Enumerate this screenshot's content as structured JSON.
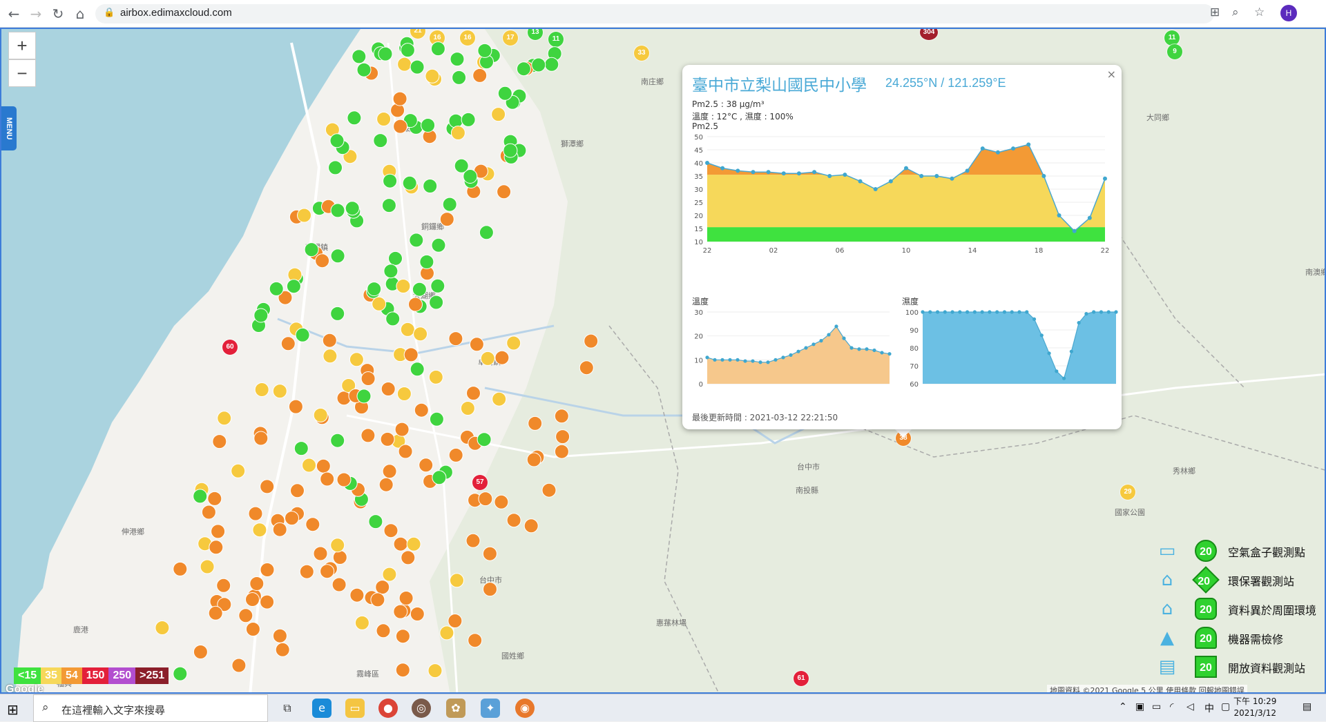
{
  "browser": {
    "url": "airbox.edimaxcloud.com",
    "profile_initial": "H"
  },
  "map_controls": {
    "zoom_in": "+",
    "zoom_out": "−",
    "menu_label": "MENU"
  },
  "place_names": [
    "南庄鄉",
    "獅潭鄉",
    "西湖鄉",
    "銅鑼鄉",
    "苑裡鎮",
    "大湖鄉",
    "卓蘭鎮",
    "大同鄉",
    "南澳鄉",
    "台中市",
    "南投縣",
    "秀林鄉",
    "國家公園",
    "伸港鄉",
    "鹿港",
    "福興",
    "國姓鄉",
    "惠蓀林場",
    "霧峰區",
    "台中市"
  ],
  "markers": [
    {
      "v": "21",
      "c": "#f6c93e"
    },
    {
      "v": "16",
      "c": "#f6c93e"
    },
    {
      "v": "16",
      "c": "#f6c93e"
    },
    {
      "v": "17",
      "c": "#f6c93e"
    },
    {
      "v": "13",
      "c": "#3fd43f"
    },
    {
      "v": "11",
      "c": "#3fd43f"
    },
    {
      "v": "33",
      "c": "#f6c93e"
    },
    {
      "v": "304",
      "c": "#a31e2c"
    },
    {
      "v": "11",
      "c": "#3fd43f"
    },
    {
      "v": "9",
      "c": "#3fd43f"
    },
    {
      "v": "60",
      "c": "#e3203a"
    },
    {
      "v": "57",
      "c": "#e3203a"
    },
    {
      "v": "38",
      "c": "#f0892a"
    },
    {
      "v": "61",
      "c": "#e3203a"
    },
    {
      "v": "29",
      "c": "#f6c93e"
    }
  ],
  "popup": {
    "title": "臺中市立梨山國民中小學",
    "coords": "24.255°N / 121.259°E",
    "pm25_reading": "Pm2.5 : 38 μg/m³",
    "temp_humidity": "溫度 : 12°C , 濕度 : 100%",
    "pm25_label": "Pm2.5",
    "temp_label": "溫度",
    "humidity_label": "濕度",
    "updated": "最後更新時間 : 2021-03-12 22:21:50",
    "close": "×"
  },
  "chart_data": [
    {
      "type": "area",
      "title": "Pm2.5",
      "x_ticks": [
        "22",
        "02",
        "06",
        "10",
        "14",
        "18",
        "22"
      ],
      "ylim": [
        10,
        50
      ],
      "y_ticks": [
        10,
        15,
        20,
        25,
        30,
        35,
        40,
        45,
        50
      ],
      "values": [
        40,
        38,
        37,
        36.5,
        36.5,
        36,
        36,
        36.5,
        35,
        35.5,
        33,
        30,
        33,
        38,
        35,
        35,
        34,
        37,
        45.5,
        44,
        45.5,
        47,
        35,
        20,
        14,
        19,
        34
      ],
      "band_colors": [
        "#3fe23f",
        "#f6d85a",
        "#f39a35"
      ]
    },
    {
      "type": "area",
      "title": "溫度",
      "ylim": [
        0,
        30
      ],
      "y_ticks": [
        0,
        10,
        20,
        30
      ],
      "values": [
        11,
        10,
        10,
        10,
        10,
        9.5,
        9.5,
        9,
        9,
        10,
        11,
        12,
        13.5,
        15,
        16.5,
        18,
        20.5,
        24,
        19,
        15,
        14.5,
        14.5,
        14,
        13,
        12.5
      ]
    },
    {
      "type": "area",
      "title": "濕度",
      "ylim": [
        60,
        100
      ],
      "y_ticks": [
        60,
        70,
        80,
        90,
        100
      ],
      "values": [
        100,
        100,
        100,
        100,
        100,
        100,
        100,
        100,
        100,
        100,
        100,
        100,
        100,
        100,
        100,
        96,
        87,
        77,
        67,
        63,
        78,
        94,
        99,
        100,
        100,
        100,
        100
      ]
    }
  ],
  "scale_legend": [
    {
      "label": "<15",
      "color": "#3fe23f"
    },
    {
      "label": "35",
      "color": "#f6d85a"
    },
    {
      "label": "54",
      "color": "#f39a35"
    },
    {
      "label": "150",
      "color": "#e3203a"
    },
    {
      "label": "250",
      "color": "#b24ecf"
    },
    {
      "label": ">251",
      "color": "#8b1f2a"
    }
  ],
  "google_logo": "Google",
  "attribution": "地圖資料 ©2021 Google    5 公里    使用條款    回報地圖錯誤",
  "station_legend": [
    {
      "icon": "airbox-icon",
      "sym": "20",
      "shape": "circle",
      "label": "空氣盒子觀測點"
    },
    {
      "icon": "government-building-icon",
      "sym": "20",
      "shape": "diamond",
      "label": "環保署觀測站"
    },
    {
      "icon": "house-icon",
      "sym": "20",
      "shape": "hexagon",
      "label": "資料異於周圍環境"
    },
    {
      "icon": "cone-icon",
      "sym": "20",
      "shape": "cone",
      "label": "機器需檢修"
    },
    {
      "icon": "data-stack-icon",
      "sym": "20",
      "shape": "square",
      "label": "開放資料觀測站"
    }
  ],
  "taskbar": {
    "search_placeholder": "在這裡輸入文字來搜尋",
    "time": "下午 10:29",
    "date": "2021/3/12",
    "ime": "中"
  }
}
